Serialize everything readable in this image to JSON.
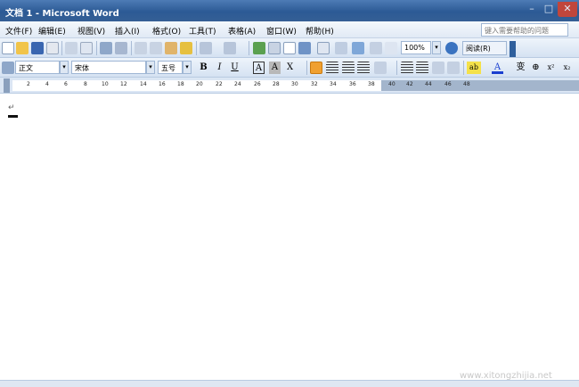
{
  "window": {
    "title": "文档 1 - Microsoft Word",
    "minimize_glyph": "–",
    "maximize_glyph": "□",
    "close_glyph": "✕"
  },
  "menu": {
    "items": [
      "文件(F)",
      "编辑(E)",
      "视图(V)",
      "插入(I)",
      "格式(O)",
      "工具(T)",
      "表格(A)",
      "窗口(W)",
      "帮助(H)"
    ],
    "help_placeholder": "键入需要帮助的问题"
  },
  "standard_toolbar": {
    "zoom": "100%",
    "read_label": "阅读(R)",
    "dropdown_glyph": "▾"
  },
  "formatting_toolbar": {
    "style": "正文",
    "font": "宋体",
    "size": "五号",
    "bold": "B",
    "italic": "I",
    "underline": "U",
    "char_border": "A",
    "char_shading": "A",
    "scale": "X",
    "phonetic": "变",
    "enclose": "⊕",
    "superscript": "x²",
    "subscript": "x₂",
    "font_color_letter": "A",
    "highlight_letter": "ab"
  },
  "ruler": {
    "numbers": [
      "2",
      "4",
      "6",
      "8",
      "10",
      "12",
      "14",
      "16",
      "18",
      "20",
      "22",
      "24",
      "26",
      "28",
      "30",
      "32",
      "34",
      "36",
      "38",
      "40",
      "42",
      "44",
      "46",
      "48"
    ]
  },
  "document": {
    "paragraph_mark": "↵"
  },
  "status": {
    "watermark": "www.xitongzhijia.net"
  },
  "colors": {
    "title_bar": "#2c5a95",
    "toolbar_bg": "#d5e2f2",
    "accent_orange": "#f0a030"
  }
}
